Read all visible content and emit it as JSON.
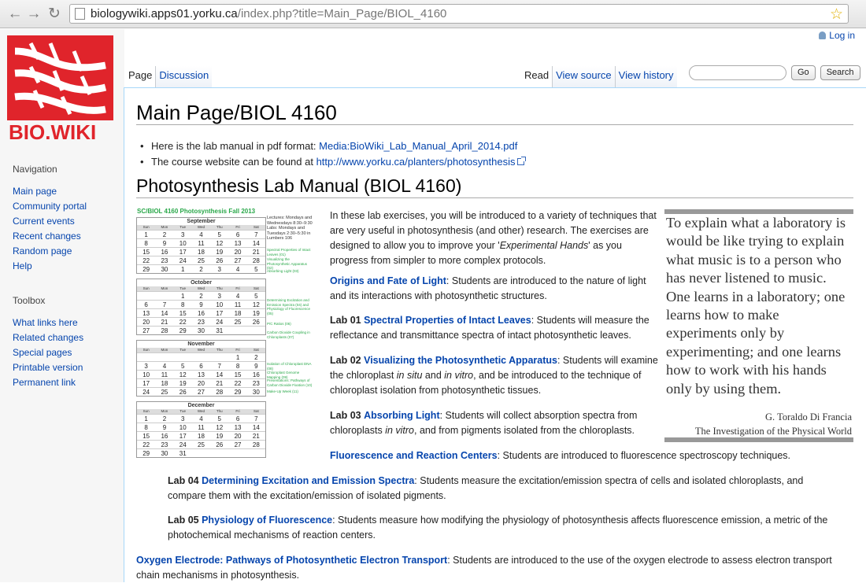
{
  "browser": {
    "url_domain": "biologywiki.apps01.yorku.ca",
    "url_path": "/index.php?title=Main_Page/BIOL_4160"
  },
  "header": {
    "login": "Log in",
    "logo_text": "BIO.WIKI"
  },
  "tabs": {
    "page": "Page",
    "discussion": "Discussion",
    "read": "Read",
    "view_source": "View source",
    "view_history": "View history"
  },
  "search": {
    "placeholder": "",
    "go": "Go",
    "search": "Search"
  },
  "sidebar": {
    "navigation_heading": "Navigation",
    "navigation": [
      "Main page",
      "Community portal",
      "Current events",
      "Recent changes",
      "Random page",
      "Help"
    ],
    "toolbox_heading": "Toolbox",
    "toolbox": [
      "What links here",
      "Related changes",
      "Special pages",
      "Printable version",
      "Permanent link"
    ]
  },
  "content": {
    "title": "Main Page/BIOL 4160",
    "bullet1_text": "Here is the lab manual in pdf format: ",
    "bullet1_link": "Media:BioWiki_Lab_Manual_April_2014.pdf",
    "bullet2_text": "The course website can be found at ",
    "bullet2_link": "http://www.yorku.ca/planters/photosynthesis",
    "heading": "Photosynthesis Lab Manual (BIOL 4160)",
    "intro_1": "In these lab exercises, you will be introduced to a variety of techniques that are very useful in photosynthesis (and other) research. The exercises are designed to allow you to improve your '",
    "intro_em": "Experimental Hands",
    "intro_2": "' as you progress from simpler to more complex protocols.",
    "origins_link": "Origins and Fate of Light",
    "origins_text": ": Students are introduced to the nature of light and its interactions with photosynthetic structures.",
    "lab01_label": "Lab 01",
    "lab01_link": "Spectral Properties of Intact Leaves",
    "lab01_text": ": Students will measure the reflectance and transmittance spectra of intact photosynthetic leaves.",
    "lab02_label": "Lab 02",
    "lab02_link": "Visualizing the Photosynthetic Apparatus",
    "lab02_text_1": ": Students will examine the chloroplast ",
    "lab02_em1": "in situ",
    "lab02_text_2": " and ",
    "lab02_em2": "in vitro",
    "lab02_text_3": ", and be introduced to the technique of chloroplast isolation from photosynthetic tissues.",
    "lab03_label": "Lab 03",
    "lab03_link": "Absorbing Light",
    "lab03_text_1": ": Students will collect absorption spectra from chloroplasts ",
    "lab03_em": "in vitro",
    "lab03_text_2": ", and from pigments isolated from the chloroplasts.",
    "fluor_link": "Fluorescence and Reaction Centers",
    "fluor_text": ": Students are introduced to fluorescence spectroscopy techniques.",
    "lab04_label": "Lab 04",
    "lab04_link": "Determining Excitation and Emission Spectra",
    "lab04_text": ": Students measure the excitation/emission spectra of cells and isolated chloroplasts, and compare them with the excitation/emission of isolated pigments.",
    "lab05_label": "Lab 05",
    "lab05_link": "Physiology of Fluorescence",
    "lab05_text": ": Students measure how modifying the physiology of photosynthesis affects fluorescence emission, a metric of the photochemical mechanisms of reaction centers.",
    "oxygen_link": "Oxygen Electrode: Pathways of Photosynthetic Electron Transport",
    "oxygen_text": ": Students are introduced to the use of the oxygen electrode to assess electron transport chain mechanisms in photosynthesis."
  },
  "quote": {
    "text": "To explain what a laboratory is would be like trying to explain what music is to a person who has never listened to music. One learns in a laboratory; one learns how to make experiments only by experimenting; and one learns how to work with his hands only by using them.",
    "author": "G. Toraldo Di Francia",
    "book": "The Investigation of the Physical World"
  },
  "calendar": {
    "title": "SC/BIOL 4160 Photosynthesis Fall 2013",
    "lectures": "Lectures: Mondays and Wednesdays 8:30–9:30 Labs: Mondays and Tuesdays 2:30–5:30 in Lumbers 106",
    "days": [
      "Sun",
      "Mon",
      "Tue",
      "Wed",
      "Thu",
      "Fri",
      "Sat"
    ],
    "months": [
      {
        "name": "September",
        "weeks": [
          [
            "1",
            "2",
            "3",
            "4",
            "5",
            "6",
            "7"
          ],
          [
            "8",
            "9",
            "10",
            "11",
            "12",
            "13",
            "14"
          ],
          [
            "15",
            "16",
            "17",
            "18",
            "19",
            "20",
            "21"
          ],
          [
            "22",
            "23",
            "24",
            "25",
            "26",
            "27",
            "28"
          ],
          [
            "29",
            "30",
            "1",
            "2",
            "3",
            "4",
            "5"
          ]
        ]
      },
      {
        "name": "October",
        "weeks": [
          [
            "",
            "",
            "1",
            "2",
            "3",
            "4",
            "5"
          ],
          [
            "6",
            "7",
            "8",
            "9",
            "10",
            "11",
            "12"
          ],
          [
            "13",
            "14",
            "15",
            "16",
            "17",
            "18",
            "19"
          ],
          [
            "20",
            "21",
            "22",
            "23",
            "24",
            "25",
            "26"
          ],
          [
            "27",
            "28",
            "29",
            "30",
            "31",
            "",
            ""
          ]
        ]
      },
      {
        "name": "November",
        "weeks": [
          [
            "",
            "",
            "",
            "",
            "",
            "1",
            "2"
          ],
          [
            "3",
            "4",
            "5",
            "6",
            "7",
            "8",
            "9"
          ],
          [
            "10",
            "11",
            "12",
            "13",
            "14",
            "15",
            "16"
          ],
          [
            "17",
            "18",
            "19",
            "20",
            "21",
            "22",
            "23"
          ],
          [
            "24",
            "25",
            "26",
            "27",
            "28",
            "29",
            "30"
          ]
        ]
      },
      {
        "name": "December",
        "weeks": [
          [
            "1",
            "2",
            "3",
            "4",
            "5",
            "6",
            "7"
          ],
          [
            "8",
            "9",
            "10",
            "11",
            "12",
            "13",
            "14"
          ],
          [
            "15",
            "16",
            "17",
            "18",
            "19",
            "20",
            "21"
          ],
          [
            "22",
            "23",
            "24",
            "25",
            "26",
            "27",
            "28"
          ],
          [
            "29",
            "30",
            "31",
            "",
            "",
            "",
            ""
          ]
        ]
      }
    ],
    "notes": [
      "Spectral Properties of Intact Leaves (01)",
      "Visualizing the Photosynthetic Apparatus (02)",
      "Absorbing Light (03)",
      "Determining Excitation and Emission Spectra (04) and Physiology of Fluorescence (05)",
      "P/C Ratios (06)",
      "Carbon Dioxide Coupling in Chloroplasts (07)",
      "Isolation of Chloroplast DNA (08)",
      "Chloroplast Genome Mapping (09)",
      "Presentations: Pathways of Carbon Dioxide Fixation (10)",
      "Make-Up Week (11)"
    ]
  },
  "colors": {
    "link": "#0645ad",
    "logo_red": "#e0242b",
    "calendar_green": "#2aa84a"
  }
}
